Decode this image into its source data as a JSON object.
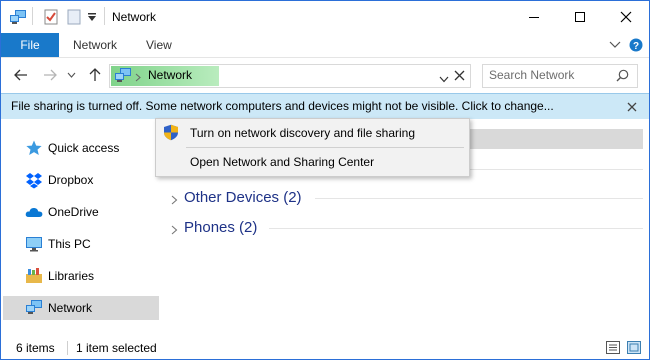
{
  "window": {
    "title": "Network",
    "ribbon_tabs": [
      "File",
      "Network",
      "View"
    ]
  },
  "address": {
    "location": "Network",
    "search_placeholder": "Search Network"
  },
  "infobar": {
    "message": "File sharing is turned off. Some network computers and devices might not be visible. Click to change..."
  },
  "context_menu": {
    "items": [
      {
        "label": "Turn on network discovery and file sharing",
        "icon": "uac-shield-icon"
      },
      {
        "label": "Open Network and Sharing Center"
      }
    ]
  },
  "navpane": {
    "items": [
      {
        "label": "Quick access",
        "icon": "star-icon"
      },
      {
        "label": "Dropbox",
        "icon": "dropbox-icon"
      },
      {
        "label": "OneDrive",
        "icon": "cloud-icon"
      },
      {
        "label": "This PC",
        "icon": "monitor-icon"
      },
      {
        "label": "Libraries",
        "icon": "library-icon"
      },
      {
        "label": "Network",
        "icon": "network-icon",
        "selected": true
      }
    ]
  },
  "content": {
    "groups": [
      {
        "title": "Other Devices (2)"
      },
      {
        "title": "Phones (2)"
      }
    ]
  },
  "statusbar": {
    "item_count": "6 items",
    "selection": "1 item selected"
  },
  "colors": {
    "accent": "#1979ca",
    "infobar_bg": "#cce8f7",
    "group_title": "#1e3287",
    "selection_bg": "#d9d9d9",
    "window_border": "#2b6fd8"
  }
}
